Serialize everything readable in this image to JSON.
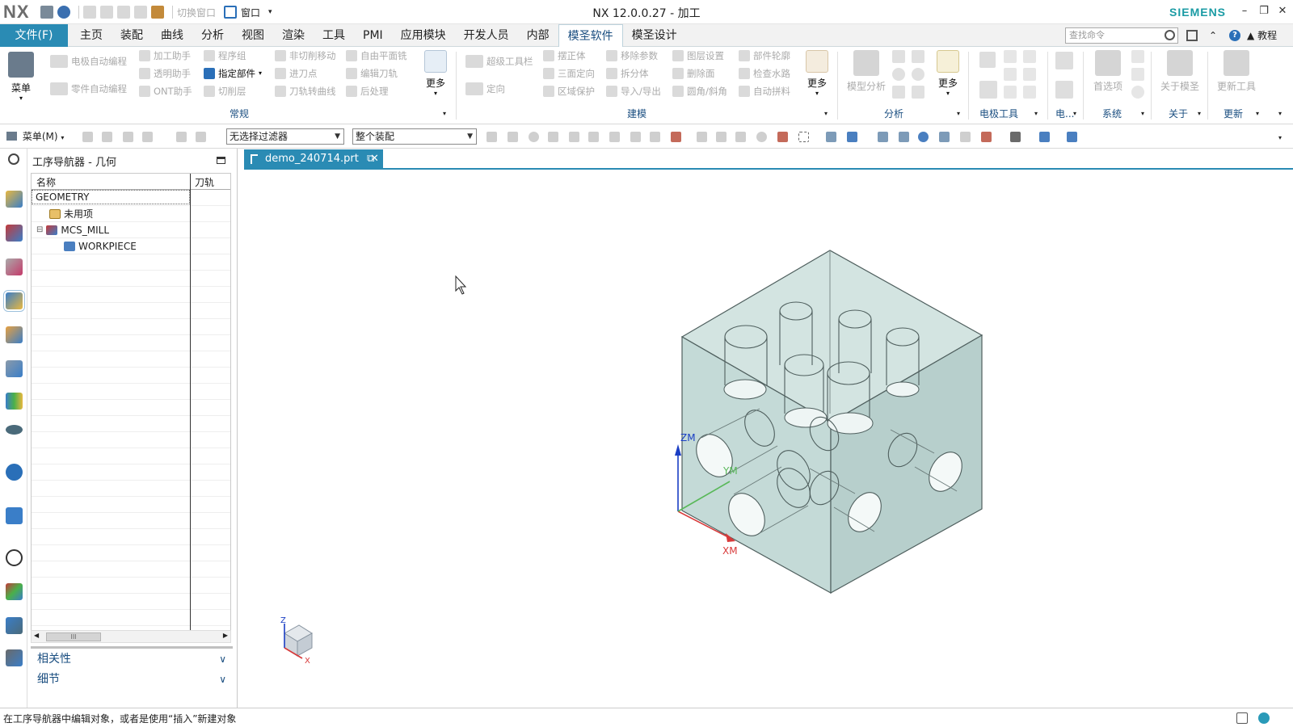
{
  "window": {
    "logo": "NX",
    "title": "NX 12.0.0.27 - 加工",
    "brand": "SIEMENS",
    "quick_access": {
      "switch_window": "切换窗口",
      "window": "窗口"
    }
  },
  "menubar": {
    "file_tab": "文件(F)",
    "tabs": [
      "主页",
      "装配",
      "曲线",
      "分析",
      "视图",
      "渲染",
      "工具",
      "PMI",
      "应用模块",
      "开发人员",
      "内部",
      "模圣软件",
      "模圣设计"
    ],
    "active_tab": "模圣软件",
    "search_placeholder": "查找命令",
    "tutorial": "教程"
  },
  "ribbon": {
    "menu_button": "菜单",
    "more": "更多",
    "groups": {
      "general": "常规",
      "modeling": "建模",
      "analysis": "分析",
      "electrode": "电极工具",
      "electrode_short": "电...",
      "system": "系统",
      "about": "关于",
      "update": "更新"
    },
    "general": [
      "电极自动编程",
      "加工助手",
      "程序组",
      "非切削移动",
      "自由平面铣",
      "零件自动编程",
      "透明助手",
      "指定部件",
      "进刀点",
      "编辑刀轨",
      "ONT助手",
      "切削层",
      "刀轨转曲线",
      "后处理"
    ],
    "modeling": [
      "超级工具栏",
      "摆正体",
      "移除参数",
      "图层设置",
      "部件轮廓",
      "三面定向",
      "拆分体",
      "删除面",
      "检查水路",
      "定向",
      "区域保护",
      "导入/导出",
      "圆角/斜角",
      "自动拼料"
    ],
    "model_analysis": "模型分析",
    "preferences": "首选项",
    "about_mosheng": "关于模圣",
    "update_tool": "更新工具"
  },
  "toolbar2": {
    "menu_label": "菜单(M)",
    "filter": "无选择过滤器",
    "scope": "整个装配"
  },
  "navigator": {
    "title": "工序导航器 - 几何",
    "col_name": "名称",
    "col_path": "刀轨",
    "rows": [
      "GEOMETRY",
      "未用项",
      "MCS_MILL",
      "WORKPIECE"
    ],
    "scroll_label": "III",
    "sections": [
      "相关性",
      "细节"
    ]
  },
  "document": {
    "tab_label": "demo_240714.prt"
  },
  "viewport": {
    "axes": {
      "z": "ZM",
      "y": "YM",
      "x": "XM"
    },
    "triad": {
      "z": "Z",
      "x": "X"
    }
  },
  "status": {
    "message": "在工序导航器中编辑对象，或者是使用“插入”新建对象"
  },
  "colors": {
    "accent": "#2a8bb4",
    "brand": "#1a9ba4",
    "part_fill": "#c4dad7",
    "part_edge": "#4f5f5e"
  }
}
